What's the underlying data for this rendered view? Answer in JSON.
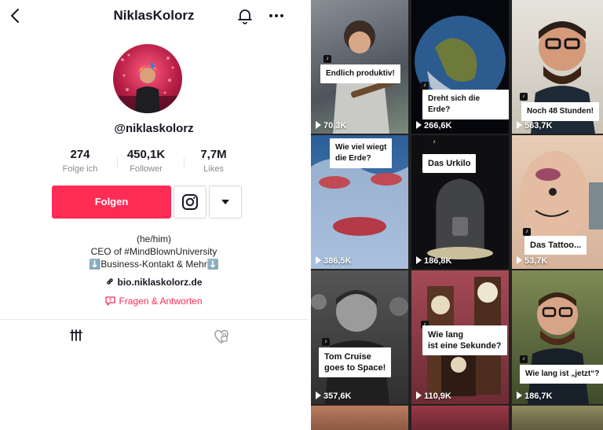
{
  "header": {
    "title": "NiklasKolorz"
  },
  "profile": {
    "handle": "@niklaskolorz",
    "stats": [
      {
        "value": "274",
        "label": "Folge ich"
      },
      {
        "value": "450,1K",
        "label": "Follower"
      },
      {
        "value": "7,7M",
        "label": "Likes"
      }
    ],
    "follow_label": "Folgen",
    "bio": [
      "(he/him)",
      "CEO of #MindBlownUniversity",
      "⬇️Business-Kontakt & Mehr⬇️"
    ],
    "link": "bio.niklaskolorz.de",
    "qa": "Fragen & Antworten"
  },
  "colors": {
    "accent": "#fe2c55"
  },
  "videos": [
    {
      "caption": "Endlich produktiv!",
      "views": "70,3K"
    },
    {
      "caption": "Dreht sich die Erde?",
      "views": "266,6K"
    },
    {
      "caption": "Noch 48 Stunden!",
      "views": "563,7K"
    },
    {
      "caption": "Wie viel wiegt\ndie Erde?",
      "views": "386,5K"
    },
    {
      "caption": "Das Urkilo",
      "views": "186,8K"
    },
    {
      "caption": "Das Tattoo...",
      "views": "53,7K"
    },
    {
      "caption": "Tom Cruise\ngoes to Space!",
      "views": "357,6K"
    },
    {
      "caption": "Wie lang\nist eine Sekunde?",
      "views": "110,9K"
    },
    {
      "caption": "Wie lang ist „jetzt“?",
      "views": "186,7K"
    }
  ]
}
